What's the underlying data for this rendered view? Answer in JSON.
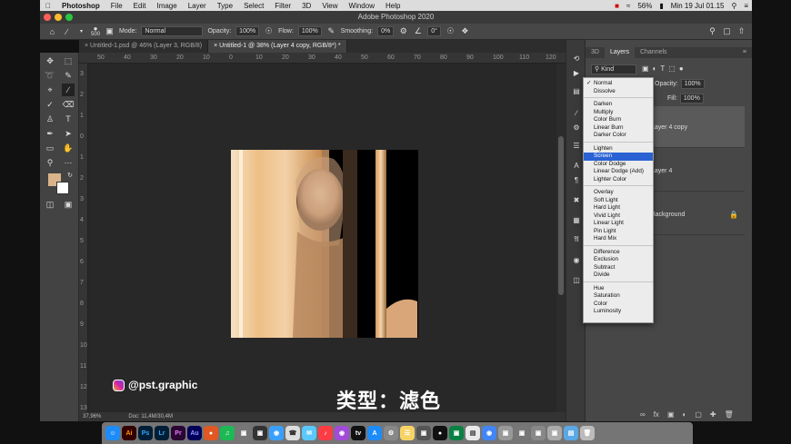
{
  "menubar": {
    "app": "Photoshop",
    "items": [
      "File",
      "Edit",
      "Image",
      "Layer",
      "Type",
      "Select",
      "Filter",
      "3D",
      "View",
      "Window",
      "Help"
    ],
    "battery": "56%",
    "clock": "Min 19 Jul 01.15"
  },
  "window": {
    "title": "Adobe Photoshop 2020"
  },
  "options": {
    "brush_size": "500",
    "mode_label": "Mode:",
    "mode_value": "Normal",
    "opacity_label": "Opacity:",
    "opacity_value": "100%",
    "flow_label": "Flow:",
    "flow_value": "100%",
    "smoothing_label": "Smoothing:",
    "smoothing_value": "0%",
    "angle_value": "0°"
  },
  "tabs": [
    {
      "label": "Untitled-1.psd @ 46% (Layer 3, RGB/8)"
    },
    {
      "label": "Untitled-1 @ 38% (Layer 4 copy, RGB/8*) *"
    }
  ],
  "rulers": {
    "h": [
      "50",
      "40",
      "30",
      "20",
      "10",
      "0",
      "10",
      "20",
      "30",
      "40",
      "50",
      "60",
      "70",
      "80",
      "90",
      "100",
      "110",
      "120",
      "130",
      "140",
      "150",
      "160",
      "170",
      "180"
    ],
    "v": [
      "3",
      "2",
      "1",
      "0",
      "1",
      "2",
      "3",
      "4",
      "5",
      "6",
      "7",
      "8",
      "9",
      "10",
      "11",
      "12",
      "13"
    ]
  },
  "status": {
    "zoom": "37,96%",
    "doc": "Doc: 11,4M/30,4M"
  },
  "colors": {
    "foreground": "#d9b48a",
    "background": "#ffffff",
    "menu_highlight": "#2a62d4"
  },
  "layers_panel": {
    "tabs": [
      "3D",
      "Layers",
      "Channels"
    ],
    "filter": "Kind",
    "opacity_label": "Opacity:",
    "opacity_value": "100%",
    "fill_label": "Fill:",
    "fill_value": "100%",
    "layers": [
      {
        "name": "Layer 4 copy"
      },
      {
        "name": "Layer 4"
      },
      {
        "name": "Background"
      }
    ]
  },
  "blend_menu": {
    "groups": [
      [
        "Normal",
        "Dissolve"
      ],
      [
        "Darken",
        "Multiply",
        "Color Burn",
        "Linear Burn",
        "Darker Color"
      ],
      [
        "Lighten",
        "Screen",
        "Color Dodge",
        "Linear Dodge (Add)",
        "Lighter Color"
      ],
      [
        "Overlay",
        "Soft Light",
        "Hard Light",
        "Vivid Light",
        "Linear Light",
        "Pin Light",
        "Hard Mix"
      ],
      [
        "Difference",
        "Exclusion",
        "Subtract",
        "Divide"
      ],
      [
        "Hue",
        "Saturation",
        "Color",
        "Luminosity"
      ]
    ],
    "checked": "Normal",
    "highlighted": "Screen"
  },
  "overlay": {
    "watermark": "@pst.graphic",
    "subtitle": "类型：滤色"
  },
  "dock": [
    "Ai",
    "Ps",
    "Lr",
    "Pr",
    "Au"
  ]
}
